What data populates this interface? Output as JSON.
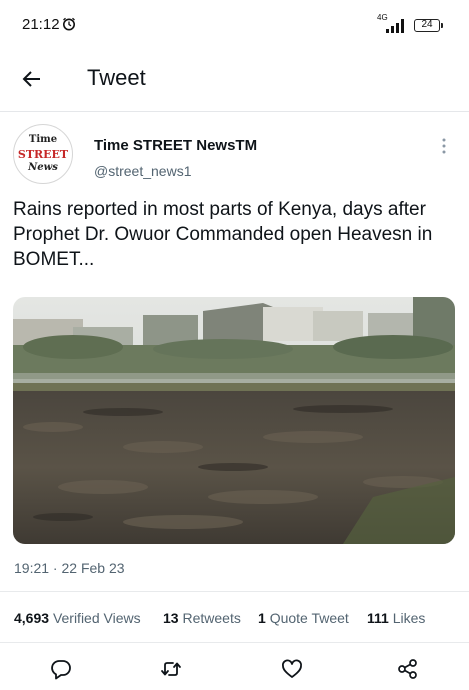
{
  "status_bar": {
    "time": "21:12",
    "network": "4G",
    "battery": "24"
  },
  "header": {
    "title": "Tweet"
  },
  "author": {
    "avatar_lines": [
      "Time",
      "STREET",
      "News"
    ],
    "name": "Time STREET NewsTM",
    "handle": "@street_news1"
  },
  "tweet": {
    "text": "Rains reported in most parts of  Kenya, days after Prophet Dr. Owuor Commanded open Heavesn in BOMET...",
    "timestamp": "19:21 · 22 Feb 23"
  },
  "stats": {
    "views_count": "4,693",
    "views_label": "Verified Views",
    "retweets_count": "13",
    "retweets_label": "Retweets",
    "quotes_count": "1",
    "quotes_label": "Quote Tweet",
    "likes_count": "111",
    "likes_label": "Likes"
  },
  "actions": [
    "reply-icon",
    "retweet-icon",
    "like-icon",
    "share-icon"
  ]
}
